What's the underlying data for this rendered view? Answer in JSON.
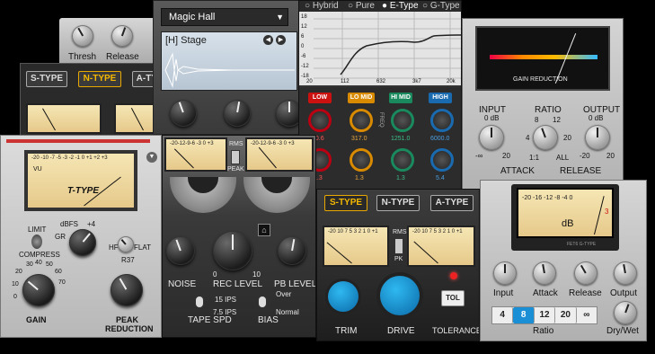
{
  "compressor_top": {
    "labels": [
      "Thresh",
      "Release"
    ]
  },
  "type_bar_left": {
    "buttons": [
      "S-TYPE",
      "N-TYPE",
      "A-TYPE"
    ],
    "active": "N-TYPE"
  },
  "reverb": {
    "preset": "Magic Hall",
    "subpreset": "[H] Stage"
  },
  "eq": {
    "modes": [
      "Hybrid",
      "Pure",
      "E-Type",
      "G-Type"
    ],
    "selected": "E-Type",
    "x_ticks": [
      "20",
      "112",
      "632",
      "3k7",
      "20k"
    ],
    "y_ticks": [
      "18",
      "12",
      "6",
      "0",
      "-6",
      "-12",
      "-18"
    ],
    "bands": [
      "LOW",
      "LO MID",
      "HI MID",
      "HIGH"
    ],
    "freq_values": [
      "10.6",
      "317.0",
      "1251.0",
      "6000.0"
    ],
    "gain_values": [
      "1.3",
      "1.3",
      "1.3",
      "5.4"
    ],
    "freq_label": "FREQ"
  },
  "gr_panel": {
    "meter_label": "GAIN REDUCTION",
    "labels": {
      "input": "INPUT",
      "input_db": "0 dB",
      "ratio": "RATIO",
      "output": "OUTPUT",
      "output_db": "0 dB",
      "attack": "ATTACK",
      "release": "RELEASE"
    },
    "ratio_ticks": [
      "8",
      "12",
      "4",
      "20",
      "1:1",
      "ALL"
    ],
    "minus_inf": "-∞",
    "plus20": "20",
    "minus20": "-20"
  },
  "ttype": {
    "meter_name": "T-TYPE",
    "meter_scale": "-20 -10 -7 -5 -3 -2 -1 0 +1 +2 +3",
    "vu": "VU",
    "labels": {
      "limit": "LIMIT",
      "compress": "COMPRESS",
      "dbfs": "dBFS",
      "plus4": "+4",
      "gr": "GR",
      "hf": "HF",
      "flat": "FLAT",
      "r37": "R37",
      "gain": "GAIN",
      "peak": "PEAK",
      "reduction": "REDUCTION"
    },
    "gain_ticks": [
      "20",
      "30",
      "40",
      "50",
      "60",
      "70",
      "10",
      "0"
    ]
  },
  "tape": {
    "rms": "RMS",
    "peak": "PEAK",
    "meter_scale": "-20-12-9-6 -3 0 +3",
    "labels": {
      "noise": "NOISE",
      "rec_level": "REC LEVEL",
      "pb_level": "PB LEVEL",
      "tape_spd": "TAPE SPD",
      "bias": "BIAS",
      "ips15": "15 IPS",
      "ips75": "7.5 IPS",
      "over": "Over",
      "normal": "Normal",
      "zero": "0",
      "ten": "10"
    }
  },
  "drive": {
    "buttons": [
      "S-TYPE",
      "N-TYPE",
      "A-TYPE"
    ],
    "active": "S-TYPE",
    "meter_scale": "-20 10 7 5 3 2 1 0 +1",
    "rms": "RMS",
    "pk": "PK",
    "labels": {
      "trim": "TRIM",
      "drive": "DRIVE",
      "tolerance": "TOLERANCE",
      "tol": "TOL"
    }
  },
  "fet": {
    "meter_scale": "-20 -16 -12 -8 -4 0",
    "db": "dB",
    "badge": "FET6 G-TYPE",
    "knobs": [
      "Input",
      "Attack",
      "Release",
      "Output"
    ],
    "ratios": [
      "4",
      "8",
      "12",
      "20",
      "∞"
    ],
    "ratio_selected": "8",
    "ratio_label": "Ratio",
    "drywet": "Dry/Wet",
    "three": "3"
  },
  "colors": {
    "panel_dark": "#2b2b2b",
    "panel_grey": "#bfbfbf",
    "meter_cream": "#f1dfaa",
    "accent_blue": "#1a8fd6",
    "active_yellow": "#e8a800",
    "red_led": "#e22"
  }
}
